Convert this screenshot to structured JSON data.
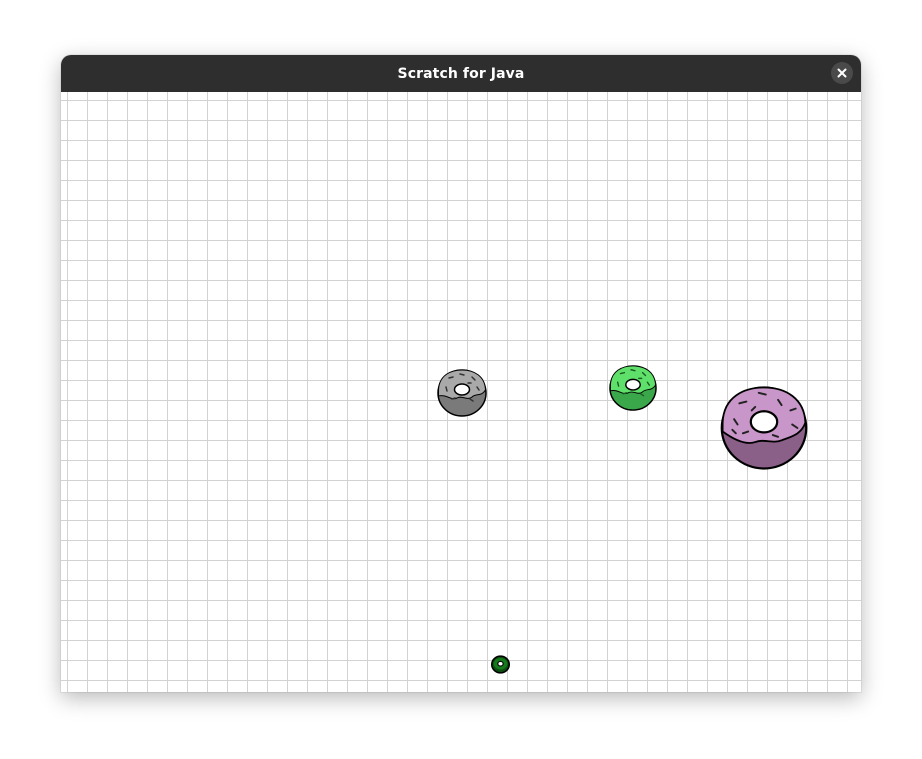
{
  "window": {
    "title": "Scratch for Java"
  },
  "icons": {
    "close": "close-icon"
  },
  "stage": {
    "background": "grid",
    "sprites": [
      {
        "name": "donut-gray",
        "dough": "#7a7a7a",
        "icing": "#a9a9a9",
        "sprinkles": "#333333"
      },
      {
        "name": "donut-green",
        "dough": "#3aa84a",
        "icing": "#5fe06a",
        "sprinkles": "#1e5d23"
      },
      {
        "name": "donut-purple",
        "dough": "#8a5f88",
        "icing": "#c896c8",
        "sprinkles": "#222222"
      },
      {
        "name": "donut-dark-green",
        "dough": "#0b4d10",
        "icing": "#157a1c",
        "sprinkles": "#000000"
      }
    ]
  }
}
